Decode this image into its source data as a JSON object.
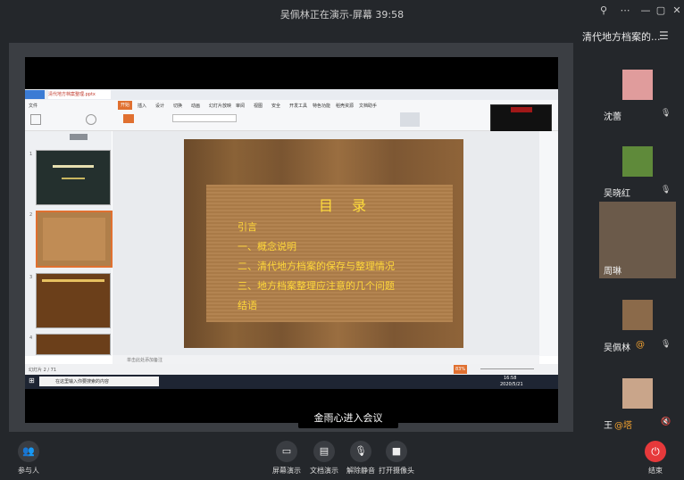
{
  "window": {
    "title": "吴佩林正在演示-屏幕 39:58",
    "pin_icon": "pin-icon",
    "more_icon": "more-icon",
    "minimize_icon": "minimize-icon",
    "maximize_icon": "maximize-icon",
    "close_icon": "close-icon"
  },
  "meeting": {
    "title": "清代地方档案的...",
    "join_notice": "金雨心进入会议"
  },
  "slide": {
    "title": "目 录",
    "lines": [
      "引言",
      "一、概念说明",
      "二、清代地方档案的保存与整理情况",
      "三、地方档案整理应注意的几个问题",
      "结语"
    ]
  },
  "wps": {
    "file_tab": "清代地方档案整理.pptx",
    "menu_items": [
      "文件",
      "开始",
      "插入",
      "设计",
      "切换",
      "动画",
      "幻灯片放映",
      "审阅",
      "视图",
      "安全",
      "开发工具",
      "特色功能",
      "稻壳资源",
      "文档助手"
    ],
    "thumb_numbers": [
      "1",
      "2",
      "3",
      "4"
    ],
    "notes_placeholder": "单击此处添加备注",
    "status_slide": "幻灯片 2 / 71",
    "zoom": "83%",
    "taskbar_search": "在这里输入你要搜索的内容",
    "clock_time": "16:58",
    "clock_date": "2020/5/21"
  },
  "participants": [
    {
      "name": "沈蕾",
      "badge": "",
      "mic": "mic-icon"
    },
    {
      "name": "吴晓红",
      "badge": "",
      "mic": "mic-icon"
    },
    {
      "name": "周琳",
      "badge": "",
      "mic": "mic-icon"
    },
    {
      "name": "吴佩林",
      "badge": "@",
      "mic": "mic-icon"
    },
    {
      "name": "王",
      "badge": "@塔",
      "mic": "mic-muted-icon"
    }
  ],
  "controls": {
    "participants_label": "参与人",
    "screen_share_label": "屏幕演示",
    "doc_share_label": "文档演示",
    "unmute_label": "解除静音",
    "camera_label": "打开摄像头",
    "end_label": "结束"
  },
  "colors": {
    "background": "#24272b",
    "slide_text": "#ffd83a",
    "end_button": "#e6393b",
    "badge": "#f0a030"
  }
}
